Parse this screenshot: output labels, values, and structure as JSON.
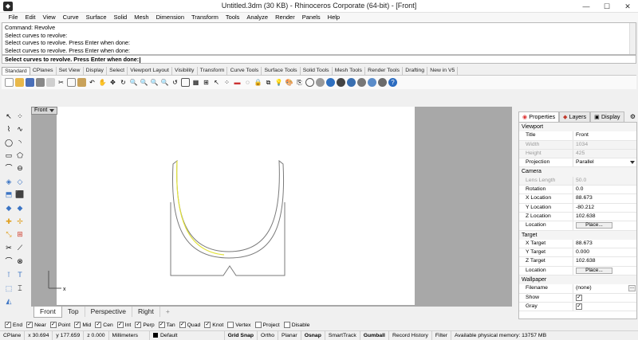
{
  "window": {
    "title": "Untitled.3dm (30 KB) - Rhinoceros Corporate (64-bit) - [Front]",
    "controls": [
      "—",
      "☐",
      "✕"
    ]
  },
  "menu": [
    "File",
    "Edit",
    "View",
    "Curve",
    "Surface",
    "Solid",
    "Mesh",
    "Dimension",
    "Transform",
    "Tools",
    "Analyze",
    "Render",
    "Panels",
    "Help"
  ],
  "command": {
    "history": [
      "Command: Revolve",
      "Select curves to revolve:",
      "Select curves to revolve. Press Enter when done:",
      "Select curves to revolve. Press Enter when done:"
    ],
    "prompt": "Select curves to revolve. Press Enter when done:"
  },
  "toolbar_tabs": [
    "Standard",
    "CPlanes",
    "Set View",
    "Display",
    "Select",
    "Viewport Layout",
    "Visibility",
    "Transform",
    "Curve Tools",
    "Surface Tools",
    "Solid Tools",
    "Mesh Tools",
    "Render Tools",
    "Drafting",
    "New in V5"
  ],
  "viewport": {
    "name": "Front",
    "axis_label": "x",
    "tabs": [
      "Front",
      "Top",
      "Perspective",
      "Right"
    ],
    "add_tab": "+",
    "curve_colors": {
      "profile": "#7a7a7a",
      "selected": "#e2e23a"
    }
  },
  "osnaps": [
    {
      "label": "End",
      "checked": true
    },
    {
      "label": "Near",
      "checked": true
    },
    {
      "label": "Point",
      "checked": true
    },
    {
      "label": "Mid",
      "checked": true
    },
    {
      "label": "Cen",
      "checked": true
    },
    {
      "label": "Int",
      "checked": true
    },
    {
      "label": "Perp",
      "checked": true
    },
    {
      "label": "Tan",
      "checked": true
    },
    {
      "label": "Quad",
      "checked": true
    },
    {
      "label": "Knot",
      "checked": true
    },
    {
      "label": "Vertex",
      "checked": false
    },
    {
      "label": "Project",
      "checked": false
    },
    {
      "label": "Disable",
      "checked": false
    }
  ],
  "status": {
    "cplane": "CPlane",
    "x": "x 30.694",
    "y": "y 177.659",
    "z": "z 0.000",
    "units": "Millimeters",
    "layer": "Default",
    "toggles": [
      "Grid Snap",
      "Ortho",
      "Planar",
      "Osnap",
      "SmartTrack",
      "Gumball",
      "Record History",
      "Filter"
    ],
    "memory": "Available physical memory: 13757 MB"
  },
  "panel": {
    "tabs": [
      "Properties",
      "Layers",
      "Display"
    ],
    "viewport_section": "Viewport",
    "title_label": "Title",
    "title_value": "Front",
    "width_label": "Width",
    "width_value": "1034",
    "height_label": "Height",
    "height_value": "425",
    "projection_label": "Projection",
    "projection_value": "Parallel",
    "camera_section": "Camera",
    "lens_label": "Lens Length",
    "lens_value": "50.0",
    "rotation_label": "Rotation",
    "rotation_value": "0.0",
    "xloc_label": "X Location",
    "xloc_value": "88.673",
    "yloc_label": "Y Location",
    "yloc_value": "-80.212",
    "zloc_label": "Z Location",
    "zloc_value": "102.638",
    "location_label": "Location",
    "place_button": "Place...",
    "target_section": "Target",
    "xtgt_label": "X Target",
    "xtgt_value": "88.673",
    "ytgt_label": "Y Target",
    "ytgt_value": "0.000",
    "ztgt_label": "Z Target",
    "ztgt_value": "102.638",
    "wallpaper_section": "Wallpaper",
    "filename_label": "Filename",
    "filename_value": "(none)",
    "browse_button": "...",
    "show_label": "Show",
    "gray_label": "Gray"
  }
}
